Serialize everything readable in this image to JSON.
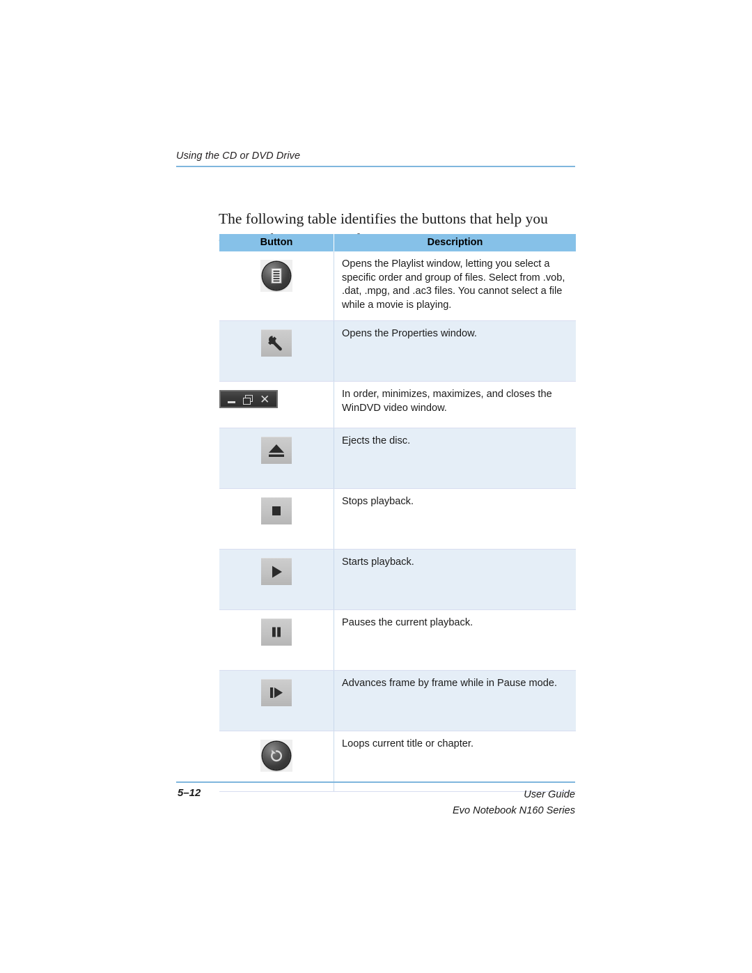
{
  "running_head": "Using the CD or DVD Drive",
  "intro_paragraph": "The following table identifies the buttons that help you operate the WinDVD player.",
  "table": {
    "headers": {
      "button": "Button",
      "description": "Description"
    },
    "rows": [
      {
        "icon": "playlist-icon",
        "description": "Opens the Playlist window, letting you select a specific order and group of files. Select from .vob, .dat, .mpg, and .ac3 files. You cannot select a file while a movie is playing."
      },
      {
        "icon": "wrench-properties-icon",
        "description": "Opens the Properties window."
      },
      {
        "icon": "window-controls-icon",
        "description": "In order, minimizes, maximizes, and closes the WinDVD video window."
      },
      {
        "icon": "eject-icon",
        "description": "Ejects the disc."
      },
      {
        "icon": "stop-icon",
        "description": "Stops playback."
      },
      {
        "icon": "play-icon",
        "description": "Starts playback."
      },
      {
        "icon": "pause-icon",
        "description": "Pauses the current playback."
      },
      {
        "icon": "frame-advance-icon",
        "description": "Advances frame by frame while in Pause mode."
      },
      {
        "icon": "loop-icon",
        "description": "Loops current title or chapter."
      }
    ]
  },
  "window_controls": {
    "minimize": "minimize-glyph",
    "maximize": "maximize-glyph",
    "close": "✕"
  },
  "footer": {
    "page_number": "5–12",
    "guide_title": "User Guide",
    "product": "Evo Notebook N160 Series"
  },
  "colors": {
    "rule": "#7fb6dd",
    "table_header_bg": "#86c1e8",
    "row_shade_bg": "#e5eef7",
    "row_border": "#d8ddf0"
  }
}
